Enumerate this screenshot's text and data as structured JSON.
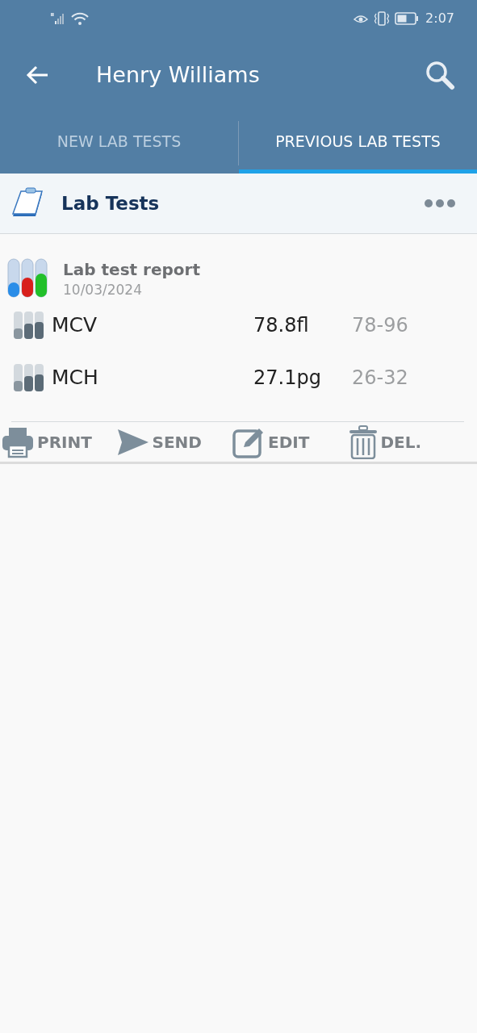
{
  "status_bar": {
    "time": "2:07"
  },
  "app_bar": {
    "title": "Henry Williams"
  },
  "tabs": [
    {
      "label": "NEW LAB TESTS",
      "selected": false
    },
    {
      "label": "PREVIOUS LAB TESTS",
      "selected": true
    }
  ],
  "section": {
    "title": "Lab Tests"
  },
  "report": {
    "title": "Lab test report",
    "date": "10/03/2024",
    "results": [
      {
        "name": "MCV",
        "value": "78.8fl",
        "range": "78-96"
      },
      {
        "name": "MCH",
        "value": "27.1pg",
        "range": "26-32"
      }
    ],
    "actions": [
      {
        "kind": "print",
        "label": "PRINT"
      },
      {
        "kind": "send",
        "label": "SEND"
      },
      {
        "kind": "edit",
        "label": "EDIT"
      },
      {
        "kind": "delete",
        "label": "DEL."
      }
    ]
  }
}
